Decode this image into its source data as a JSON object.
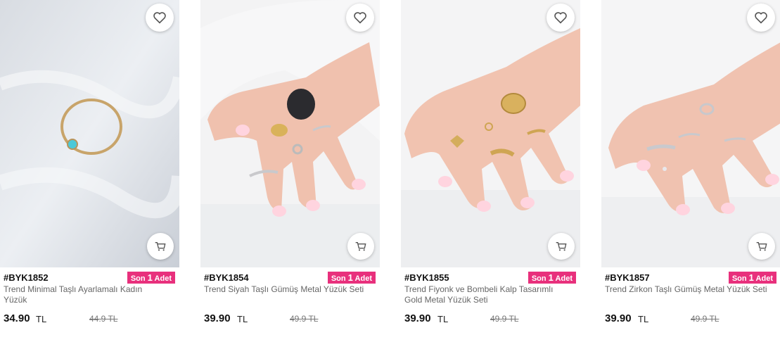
{
  "products": [
    {
      "sku": "#BYK1852",
      "stock_prefix": "Son",
      "stock_count": "1",
      "stock_suffix": "Adet",
      "title": "Trend Minimal Taşlı Ayarlamalı Kadın Yüzük",
      "price": "34.90",
      "currency": "TL",
      "old_price": "44.9 TL"
    },
    {
      "sku": "#BYK1854",
      "stock_prefix": "Son",
      "stock_count": "1",
      "stock_suffix": "Adet",
      "title": "Trend Siyah Taşlı Gümüş Metal Yüzük Seti",
      "price": "39.90",
      "currency": "TL",
      "old_price": "49.9 TL"
    },
    {
      "sku": "#BYK1855",
      "stock_prefix": "Son",
      "stock_count": "1",
      "stock_suffix": "Adet",
      "title": "Trend Fiyonk ve Bombeli Kalp Tasarımlı Gold Metal Yüzük Seti",
      "price": "39.90",
      "currency": "TL",
      "old_price": "49.9 TL"
    },
    {
      "sku": "#BYK1857",
      "stock_prefix": "Son",
      "stock_count": "1",
      "stock_suffix": "Adet",
      "title": "Trend Zirkon Taşlı Gümüş Metal Yüzük Seti",
      "price": "39.90",
      "currency": "TL",
      "old_price": "49.9 TL"
    }
  ],
  "icons": {
    "favorite": "heart-icon",
    "cart": "cart-icon"
  },
  "colors": {
    "badge": "#e8307c",
    "text": "#111111",
    "muted": "#666666"
  }
}
